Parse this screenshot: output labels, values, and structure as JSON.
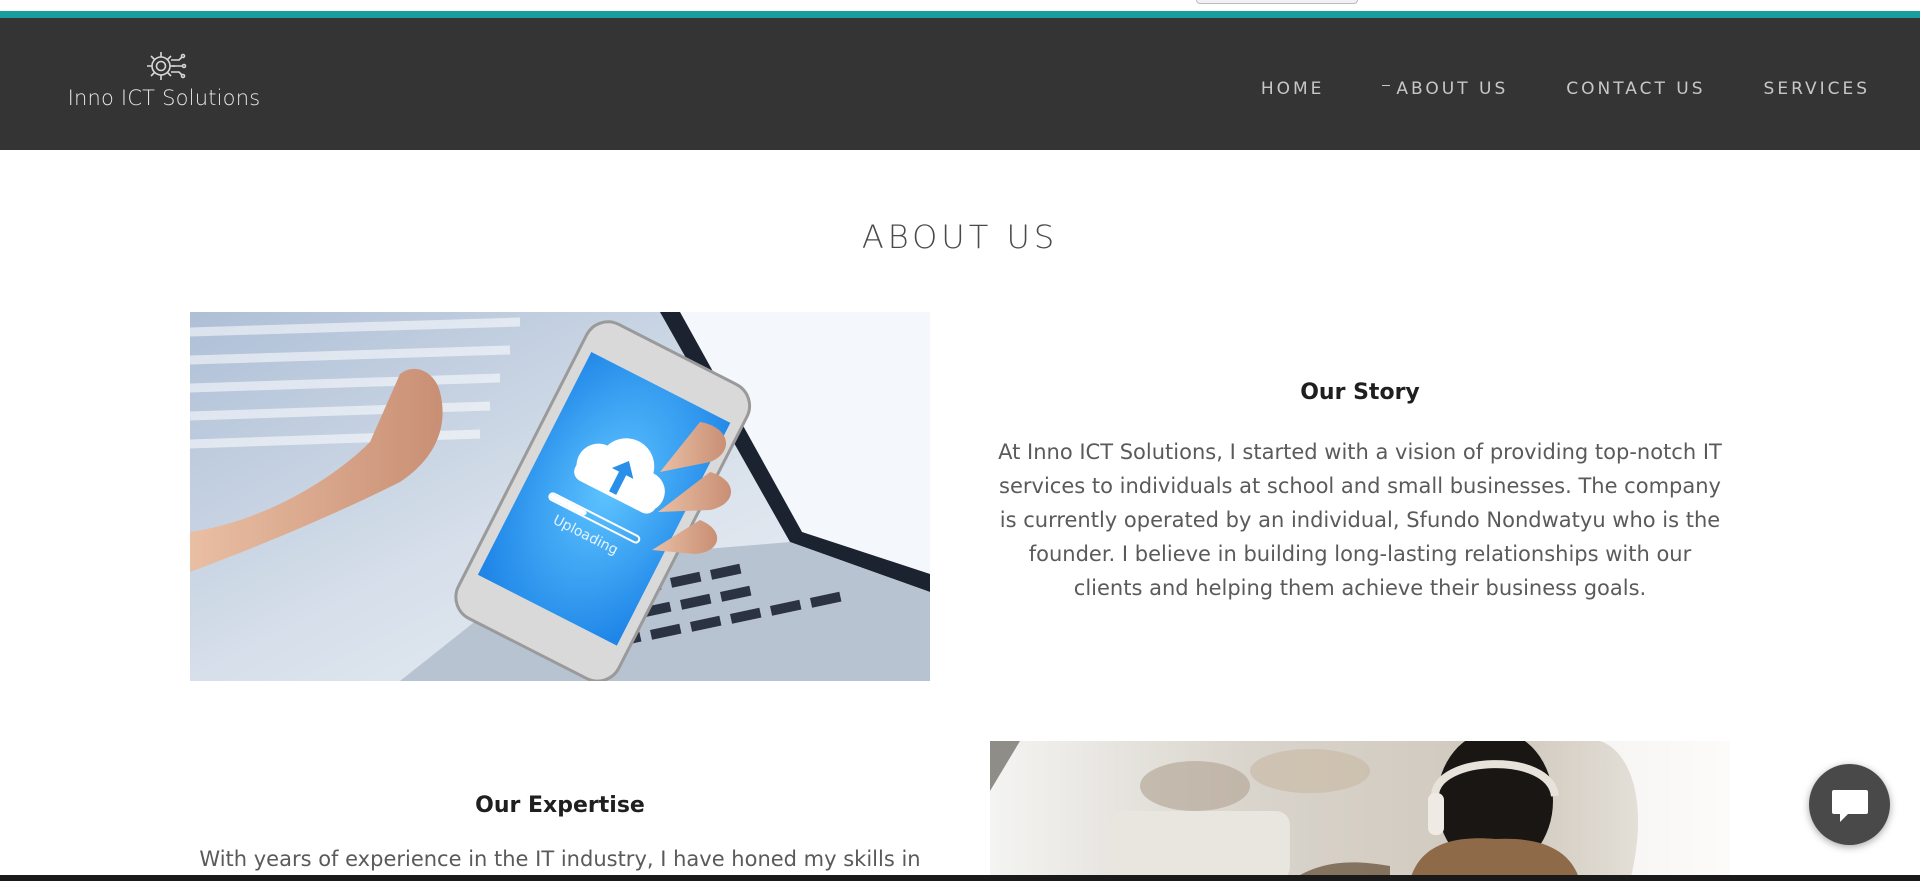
{
  "brand": {
    "name": "Inno ICT Solutions",
    "accent_color": "#1a9d9f",
    "header_bg": "#343434"
  },
  "nav": {
    "items": [
      {
        "label": "HOME",
        "active": false
      },
      {
        "label": "ABOUT US",
        "active": true
      },
      {
        "label": "CONTACT US",
        "active": false
      },
      {
        "label": "SERVICES",
        "active": false
      }
    ]
  },
  "page": {
    "title": "ABOUT US"
  },
  "sections": {
    "story": {
      "heading": "Our Story",
      "body": "At Inno ICT Solutions, I started with a vision of providing top-notch IT services to individuals at school and  small businesses. The company is currently operated by an individual, Sfundo Nondwatyu who is the founder. I believe in building long-lasting relationships with our clients and helping them achieve their business goals.",
      "image_icon": "phone-upload-image"
    },
    "expertise": {
      "heading": "Our Expertise",
      "body": "With years of experience in the IT industry, I have honed my skills in",
      "image_icon": "person-headphones-image"
    }
  },
  "phone_screen_text": "Uploading",
  "chat": {
    "icon": "chat-bubble-icon"
  }
}
